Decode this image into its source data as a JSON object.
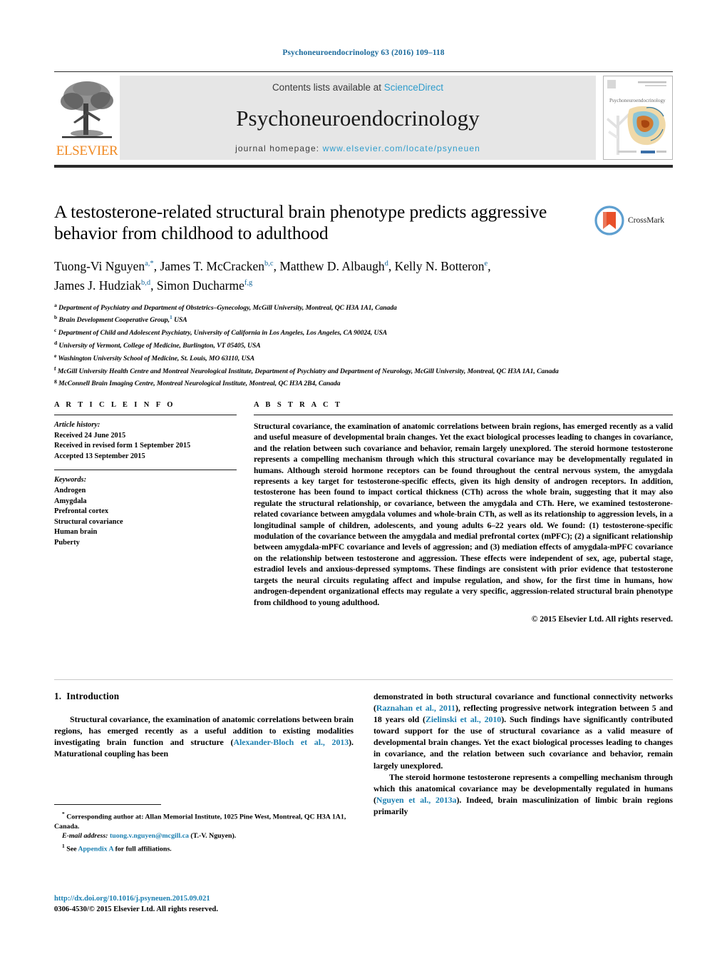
{
  "running_head": "Psychoneuroendocrinology 63 (2016) 109–118",
  "masthead": {
    "contents_prefix": "Contents lists available at ",
    "contents_link": "ScienceDirect",
    "journal_title": "Psychoneuroendocrinology",
    "homepage_prefix": "journal homepage: ",
    "homepage_url": "www.elsevier.com/locate/psyneuen",
    "publisher": "ELSEVIER",
    "cover_journal_title": "Psychoneuroendocrinology",
    "link_color": "#2e9ccc",
    "publisher_color": "#f08a24"
  },
  "article": {
    "title": "A testosterone-related structural brain phenotype predicts aggressive behavior from childhood to adulthood",
    "crossmark_label": "CrossMark",
    "authors_line1": "Tuong-Vi Nguyen",
    "authors": [
      {
        "name": "Tuong-Vi Nguyen",
        "sup": "a,*"
      },
      {
        "name": "James T. McCracken",
        "sup": "b,c"
      },
      {
        "name": "Matthew D. Albaugh",
        "sup": "d"
      },
      {
        "name": "Kelly N. Botteron",
        "sup": "e"
      },
      {
        "name": "James J. Hudziak",
        "sup": "b,d"
      },
      {
        "name": "Simon Ducharme",
        "sup": "f,g"
      }
    ],
    "affiliations": [
      {
        "mark": "a",
        "text": "Department of Psychiatry and Department of Obstetrics–Gynecology, McGill University, Montreal, QC H3A 1A1, Canada"
      },
      {
        "mark": "b",
        "text": "Brain Development Cooperative Group,",
        "note": "1",
        "text2": " USA"
      },
      {
        "mark": "c",
        "text": "Department of Child and Adolescent Psychiatry, University of California in Los Angeles, Los Angeles, CA 90024, USA"
      },
      {
        "mark": "d",
        "text": "University of Vermont, College of Medicine, Burlington, VT 05405, USA"
      },
      {
        "mark": "e",
        "text": "Washington University School of Medicine, St. Louis, MO 63110, USA"
      },
      {
        "mark": "f",
        "text": "McGill University Health Centre and Montreal Neurological Institute, Department of Psychiatry and Department of Neurology, McGill University, Montreal, QC H3A 1A1, Canada"
      },
      {
        "mark": "g",
        "text": "McConnell Brain Imaging Centre, Montreal Neurological Institute, Montreal, QC H3A 2B4, Canada"
      }
    ]
  },
  "article_info": {
    "heading": "A R T I C L E    I N F O",
    "history_label": "Article history:",
    "history": [
      "Received 24 June 2015",
      "Received in revised form 1 September 2015",
      "Accepted 13 September 2015"
    ],
    "keywords_label": "Keywords:",
    "keywords": [
      "Androgen",
      "Amygdala",
      "Prefrontal cortex",
      "Structural covariance",
      "Human brain",
      "Puberty"
    ]
  },
  "abstract": {
    "heading": "A B S T R A C T",
    "text": "Structural covariance, the examination of anatomic correlations between brain regions, has emerged recently as a valid and useful measure of developmental brain changes. Yet the exact biological processes leading to changes in covariance, and the relation between such covariance and behavior, remain largely unexplored. The steroid hormone testosterone represents a compelling mechanism through which this structural covariance may be developmentally regulated in humans. Although steroid hormone receptors can be found throughout the central nervous system, the amygdala represents a key target for testosterone-specific effects, given its high density of androgen receptors. In addition, testosterone has been found to impact cortical thickness (CTh) across the whole brain, suggesting that it may also regulate the structural relationship, or covariance, between the amygdala and CTh. Here, we examined testosterone-related covariance between amygdala volumes and whole-brain CTh, as well as its relationship to aggression levels, in a longitudinal sample of children, adolescents, and young adults 6–22 years old. We found: (1) testosterone-specific modulation of the covariance between the amygdala and medial prefrontal cortex (mPFC); (2) a significant relationship between amygdala-mPFC covariance and levels of aggression; and (3) mediation effects of amygdala-mPFC covariance on the relationship between testosterone and aggression. These effects were independent of sex, age, pubertal stage, estradiol levels and anxious-depressed symptoms. These findings are consistent with prior evidence that testosterone targets the neural circuits regulating affect and impulse regulation, and show, for the first time in humans, how androgen-dependent organizational effects may regulate a very specific, aggression-related structural brain phenotype from childhood to young adulthood.",
    "copyright": "© 2015 Elsevier Ltd. All rights reserved."
  },
  "introduction": {
    "number": "1.",
    "heading": "Introduction",
    "left_p1_a": "Structural covariance, the examination of anatomic correlations between brain regions, has emerged recently as a useful addition to existing modalities investigating brain function and structure (",
    "left_p1_ref": "Alexander-Bloch et al., 2013",
    "left_p1_b": "). Maturational coupling has been",
    "right_p1_a": "demonstrated in both structural covariance and functional connectivity networks (",
    "right_p1_ref1": "Raznahan et al., 2011",
    "right_p1_b": "), reflecting progressive network integration between 5 and 18 years old (",
    "right_p1_ref2": "Zielinski et al., 2010",
    "right_p1_c": "). Such findings have significantly contributed toward support for the use of structural covariance as a valid measure of developmental brain changes. Yet the exact biological processes leading to changes in covariance, and the relation between such covariance and behavior, remain largely unexplored.",
    "right_p2_a": "The steroid hormone testosterone represents a compelling mechanism through which this anatomical covariance may be developmentally regulated in humans (",
    "right_p2_ref": "Nguyen et al., 2013a",
    "right_p2_b": "). Indeed, brain masculinization of limbic brain regions primarily"
  },
  "footnotes": {
    "corresponding_mark": "*",
    "corresponding": " Corresponding author at: Allan Memorial Institute, 1025 Pine West, Montreal, QC H3A 1A1, Canada.",
    "email_label": "E-mail address:",
    "email": "tuong.v.nguyen@mcgill.ca",
    "email_suffix": " (T.-V. Nguyen).",
    "appendix_mark": "1",
    "appendix_prefix": " See ",
    "appendix_link": "Appendix A",
    "appendix_suffix": " for full affiliations."
  },
  "footer": {
    "doi": "http://dx.doi.org/10.1016/j.psyneuen.2015.09.021",
    "issn_line": "0306-4530/© 2015 Elsevier Ltd. All rights reserved."
  }
}
